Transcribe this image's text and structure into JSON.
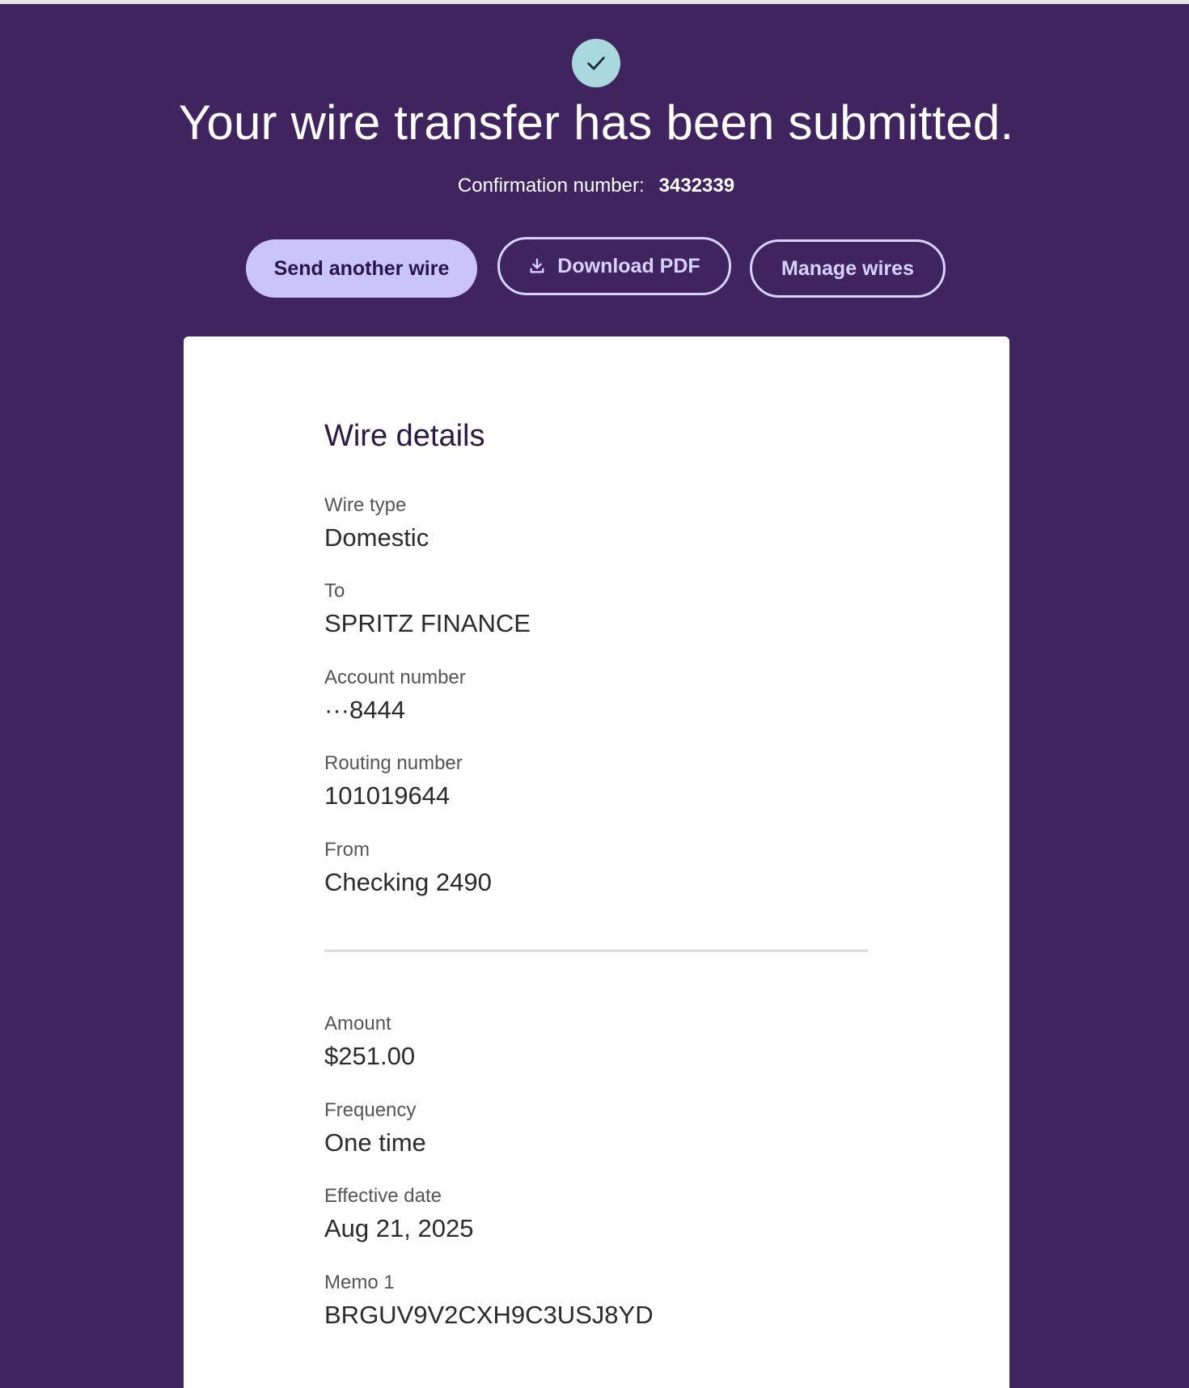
{
  "header": {
    "title": "Your wire transfer has been submitted.",
    "confirmation_label": "Confirmation number:",
    "confirmation_number": "3432339"
  },
  "actions": {
    "send_another": "Send another wire",
    "download_pdf": "Download PDF",
    "manage_wires": "Manage wires"
  },
  "details": {
    "title": "Wire details",
    "wire_type": {
      "label": "Wire type",
      "value": "Domestic"
    },
    "to": {
      "label": "To",
      "value": "SPRITZ FINANCE"
    },
    "account": {
      "label": "Account number",
      "value": "···8444"
    },
    "routing": {
      "label": "Routing number",
      "value": "101019644"
    },
    "from": {
      "label": "From",
      "value": "Checking 2490"
    },
    "amount": {
      "label": "Amount",
      "value": "$251.00"
    },
    "frequency": {
      "label": "Frequency",
      "value": "One time"
    },
    "effective_date": {
      "label": "Effective date",
      "value": "Aug 21, 2025"
    },
    "memo1": {
      "label": "Memo 1",
      "value": "BRGUV9V2CXH9C3USJ8YD"
    }
  },
  "icons": {
    "success": "checkmark-icon",
    "download": "download-icon"
  },
  "colors": {
    "background": "#3f2460",
    "check_circle": "#a9d9dc",
    "primary_button": "#c9c5fb",
    "outline_button": "#d6d2ff",
    "card": "#ffffff"
  }
}
